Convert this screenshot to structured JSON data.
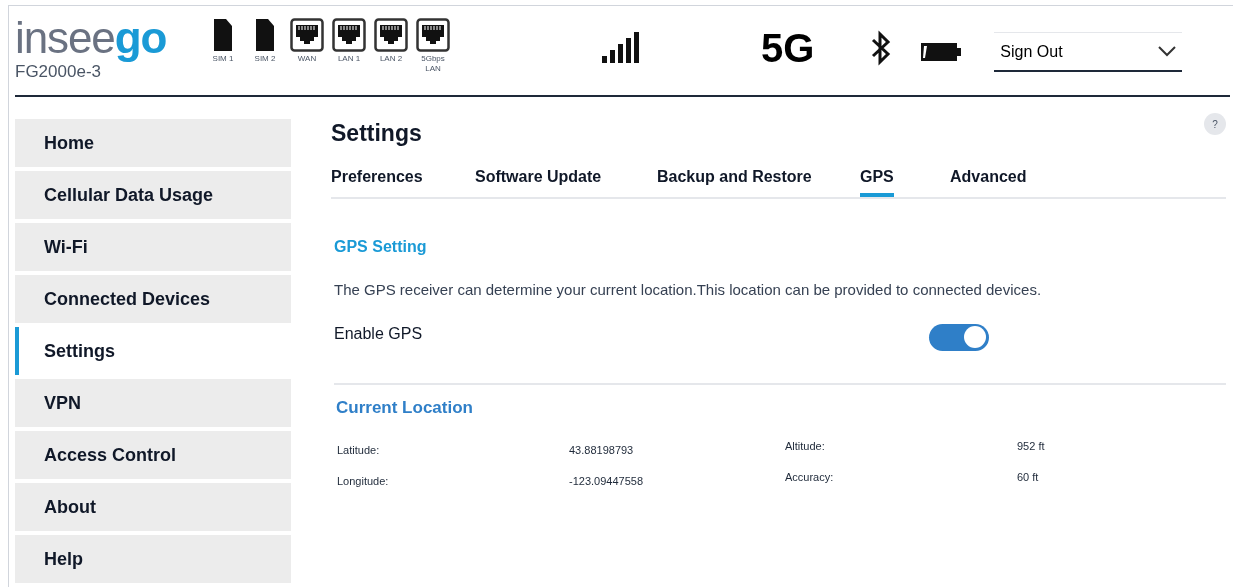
{
  "header": {
    "brand_light": "insee",
    "brand_bold": "go",
    "device": "FG2000e-3",
    "ports": [
      {
        "kind": "sim",
        "label": "SIM 1"
      },
      {
        "kind": "sim",
        "label": "SIM 2"
      },
      {
        "kind": "ethernet",
        "label": "WAN"
      },
      {
        "kind": "ethernet",
        "label": "LAN 1"
      },
      {
        "kind": "ethernet",
        "label": "LAN 2"
      },
      {
        "kind": "ethernet",
        "label": "5Gbps LAN"
      }
    ],
    "network": "5G",
    "account_menu": "Sign Out"
  },
  "sidebar": {
    "items": [
      {
        "label": "Home",
        "selected": false
      },
      {
        "label": "Cellular Data Usage",
        "selected": false
      },
      {
        "label": "Wi-Fi",
        "selected": false
      },
      {
        "label": "Connected Devices",
        "selected": false
      },
      {
        "label": "Settings",
        "selected": true
      },
      {
        "label": "VPN",
        "selected": false
      },
      {
        "label": "Access Control",
        "selected": false
      },
      {
        "label": "About",
        "selected": false
      },
      {
        "label": "Help",
        "selected": false
      }
    ]
  },
  "page": {
    "title": "Settings",
    "help": "?",
    "tabs": [
      {
        "label": "Preferences",
        "selected": false
      },
      {
        "label": "Software Update",
        "selected": false
      },
      {
        "label": "Backup and Restore",
        "selected": false
      },
      {
        "label": "GPS",
        "selected": true
      },
      {
        "label": "Advanced",
        "selected": false
      }
    ],
    "gps_setting": {
      "heading": "GPS Setting",
      "description": "The GPS receiver can determine your current location.This location can be provided to connected devices.",
      "toggle_label": "Enable GPS",
      "enabled": true
    },
    "current_location": {
      "heading": "Current Location",
      "fields": [
        {
          "label": "Latitude:",
          "value": "43.88198793"
        },
        {
          "label": "Longitude:",
          "value": "-123.09447558"
        },
        {
          "label": "Altitude:",
          "value": "952 ft"
        },
        {
          "label": "Accuracy:",
          "value": "60 ft"
        }
      ]
    }
  }
}
